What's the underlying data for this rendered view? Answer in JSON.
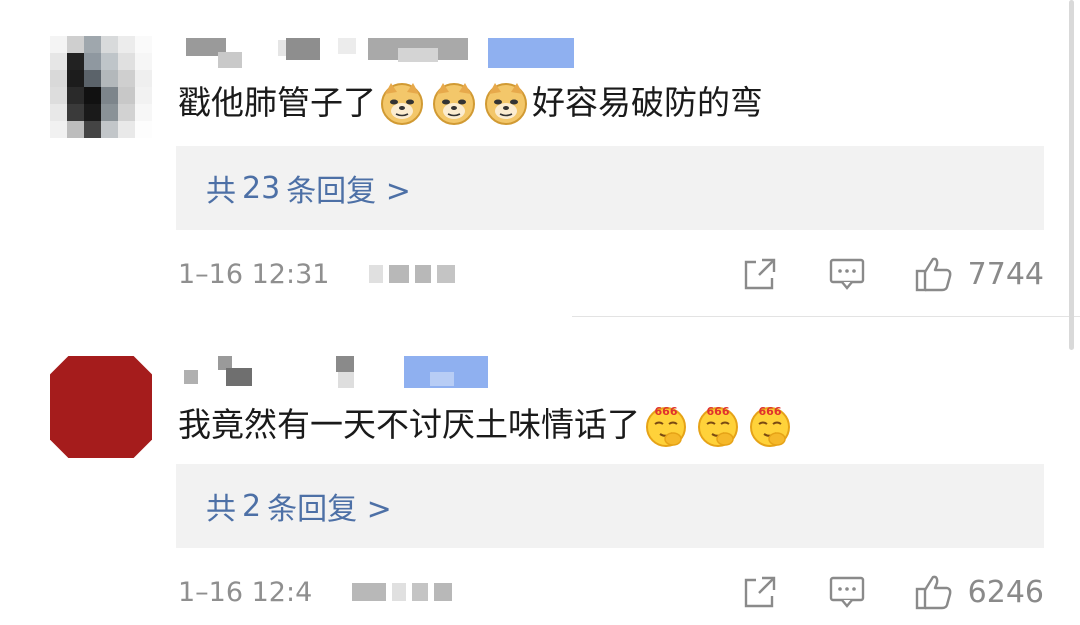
{
  "comments": [
    {
      "text_before": "戳他肺管子了",
      "text_after": "好容易破防的弯",
      "emoji": "doge-emoji",
      "emoji_count": 3,
      "replies_prefix": "共",
      "replies_count": "23",
      "replies_suffix": "条回复 >",
      "time": "1–16 12:31",
      "likes": "7744"
    },
    {
      "text_before": "我竟然有一天不讨厌土味情话了",
      "text_after": "",
      "emoji": "666-emoji",
      "emoji_count": 3,
      "replies_prefix": "共",
      "replies_count": "2",
      "replies_suffix": "条回复 >",
      "time": "1–16 12:4",
      "likes": "6246"
    }
  ],
  "colors": {
    "link": "#4d70a6",
    "reply_bg": "#f2f2f2",
    "meta": "#8f8f8f",
    "avatar2": "#a51c1c"
  },
  "icons": [
    "share-icon",
    "comment-icon",
    "like-icon"
  ]
}
